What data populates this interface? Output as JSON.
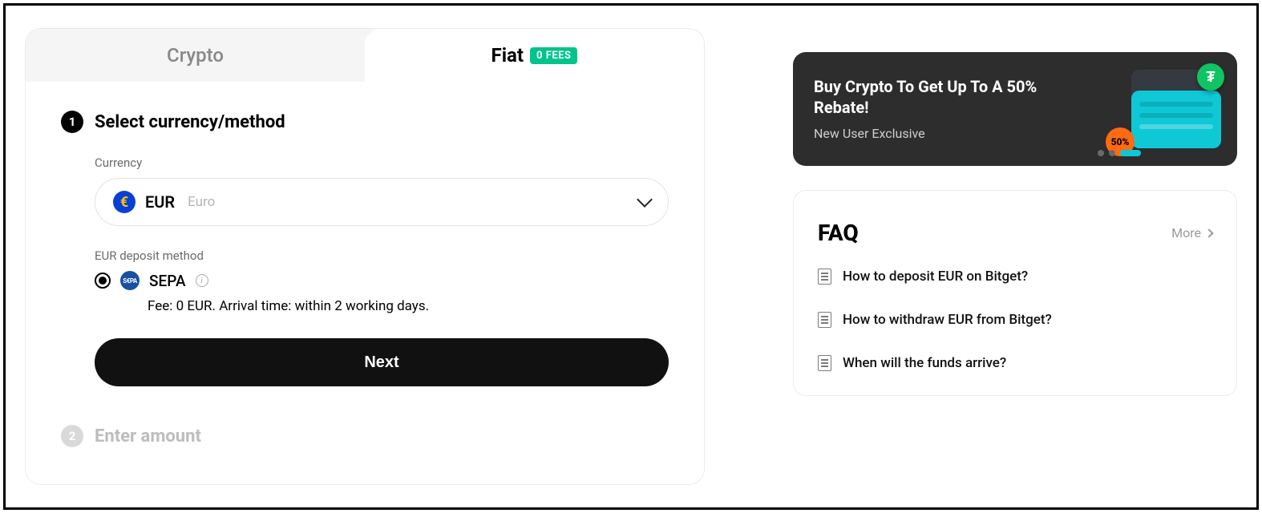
{
  "tabs": {
    "crypto": "Crypto",
    "fiat": "Fiat",
    "fees_badge": "0 FEES"
  },
  "step1": {
    "num": "1",
    "title": "Select currency/method",
    "currency_label": "Currency",
    "currency_code": "EUR",
    "currency_name": "Euro",
    "method_label": "EUR deposit method",
    "method_name": "SEPA",
    "method_sub": "Fee: 0 EUR. Arrival time: within 2 working days.",
    "next": "Next"
  },
  "step2": {
    "num": "2",
    "title": "Enter amount"
  },
  "promo": {
    "title": "Buy Crypto To Get Up To A 50% Rebate!",
    "sub": "New User Exclusive",
    "coin_symbol": "₮",
    "pct": "50%"
  },
  "faq": {
    "title": "FAQ",
    "more": "More",
    "items": [
      "How to deposit EUR on Bitget?",
      "How to withdraw EUR from Bitget?",
      "When will the funds arrive?"
    ]
  }
}
